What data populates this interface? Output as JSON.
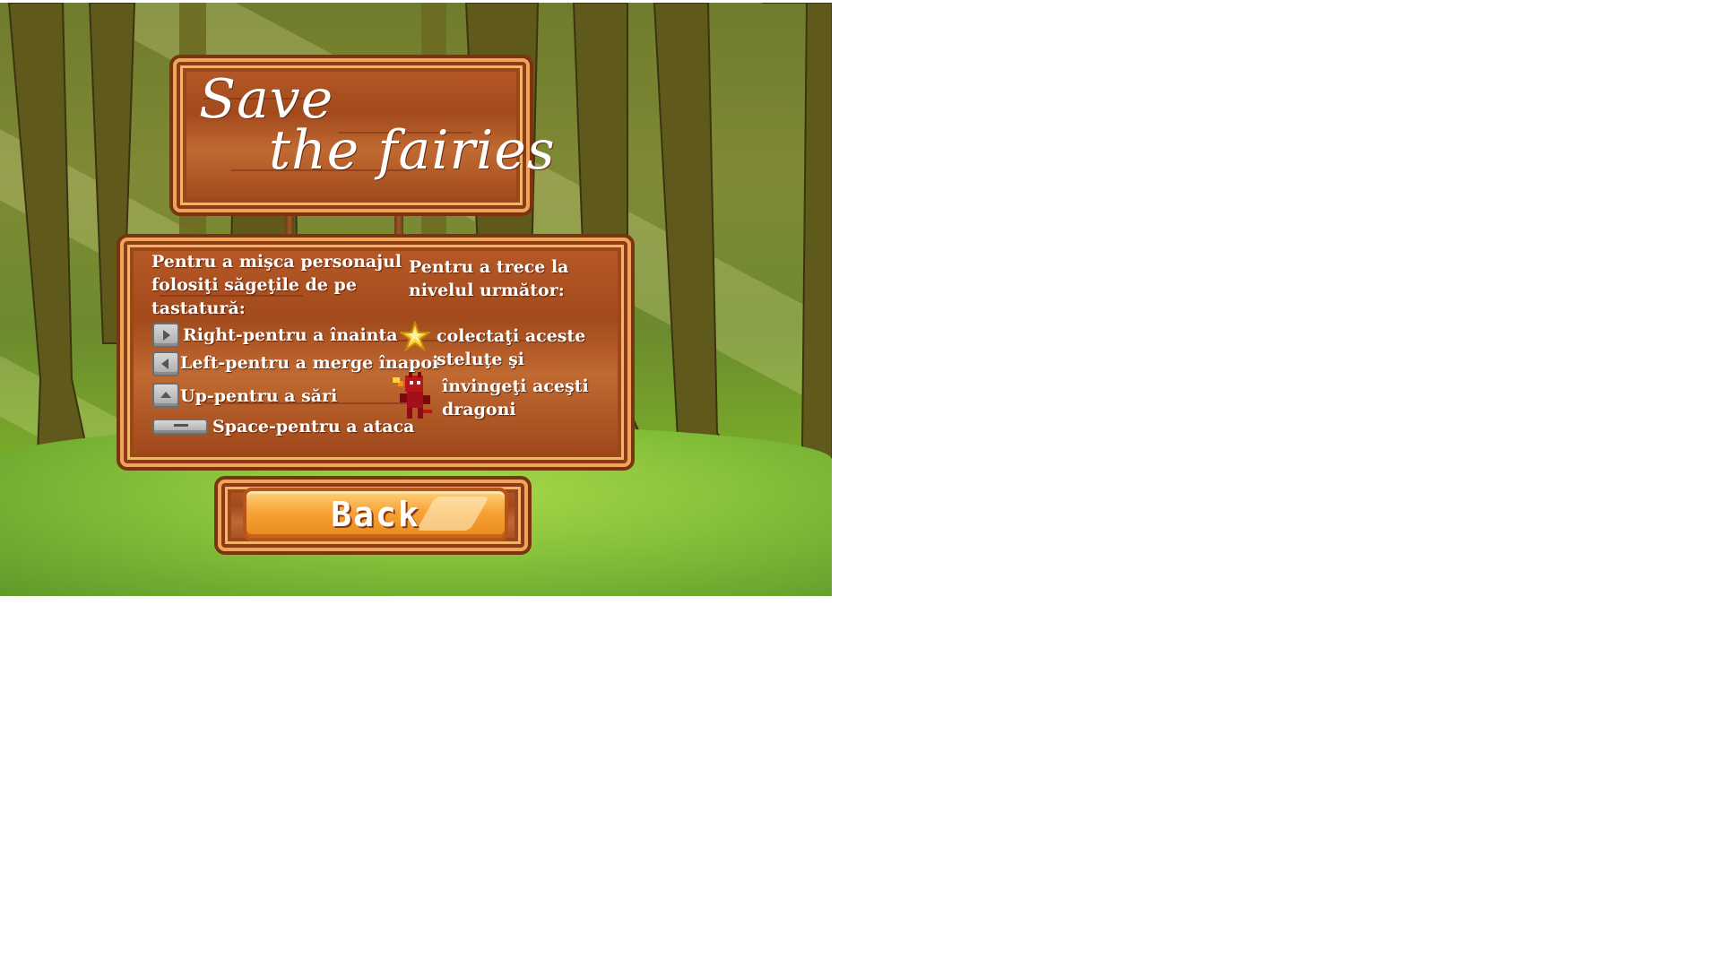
{
  "game": {
    "title_line1": "Save",
    "title_line2": "the fairies"
  },
  "instructions": {
    "move_heading": "Pentru a mişca personajul folosiţi săgeţile de pe tastatură:",
    "move_heading_line1": "Pentru a mişca personajul",
    "move_heading_line2": "folosiţi săgeţile de pe",
    "move_heading_line3": "tastatură:",
    "controls": [
      {
        "key_icon": "right-arrow-key-icon",
        "text": "Right-pentru a înainta"
      },
      {
        "key_icon": "left-arrow-key-icon",
        "text": "Left-pentru a merge înapoi"
      },
      {
        "key_icon": "up-arrow-key-icon",
        "text": "Up-pentru a sări"
      },
      {
        "key_icon": "spacebar-key-icon",
        "text": "Space-pentru a ataca"
      }
    ],
    "level_heading_line1": "Pentru a trece la",
    "level_heading_line2": "nivelul următor:",
    "goal_star_line1": "colectaţi aceste",
    "goal_star_line2": "steluţe şi",
    "goal_dragon_line1": "învingeţi aceşti",
    "goal_dragon_line2": "dragoni",
    "star_icon": "star-icon",
    "dragon_icon": "dragon-icon"
  },
  "buttons": {
    "back_label": "Back"
  },
  "colors": {
    "wood": "#a94e1f",
    "wood_border": "#f0a45a",
    "button_orange": "#f7a236",
    "forest_green": "#86c33b"
  }
}
